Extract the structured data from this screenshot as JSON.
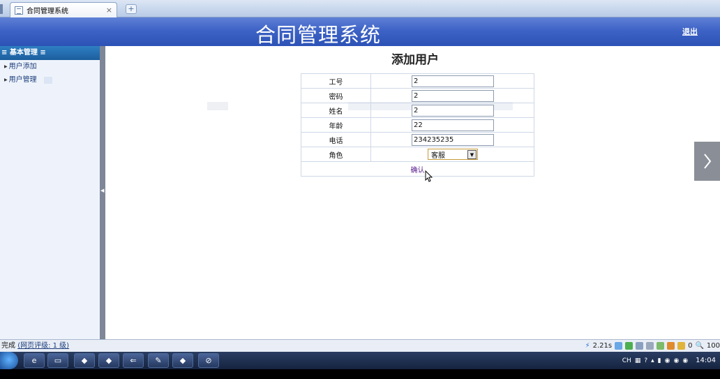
{
  "browser": {
    "tab_title": "合同管理系统",
    "tab_close": "×",
    "new_tab": "+"
  },
  "header": {
    "title": "合同管理系统",
    "logout": "退出"
  },
  "sidebar": {
    "section_title": "≡ 基本管理 ≡",
    "items": [
      {
        "label": "用户添加"
      },
      {
        "label": "用户管理"
      }
    ]
  },
  "main": {
    "page_title": "添加用户",
    "fields": [
      {
        "label": "工号",
        "value": "2"
      },
      {
        "label": "密码",
        "value": "2"
      },
      {
        "label": "姓名",
        "value": "2"
      },
      {
        "label": "年龄",
        "value": "22"
      },
      {
        "label": "电话",
        "value": "234235235"
      }
    ],
    "role": {
      "label": "角色",
      "selected": "客服"
    },
    "confirm": "确认"
  },
  "statusbar": {
    "done": "完成",
    "rating": "(网页评级: 1 级)",
    "time": "2.21s",
    "count": "0",
    "zoom": "100"
  },
  "taskbar": {
    "lang": "CH",
    "clock": "14:04"
  }
}
